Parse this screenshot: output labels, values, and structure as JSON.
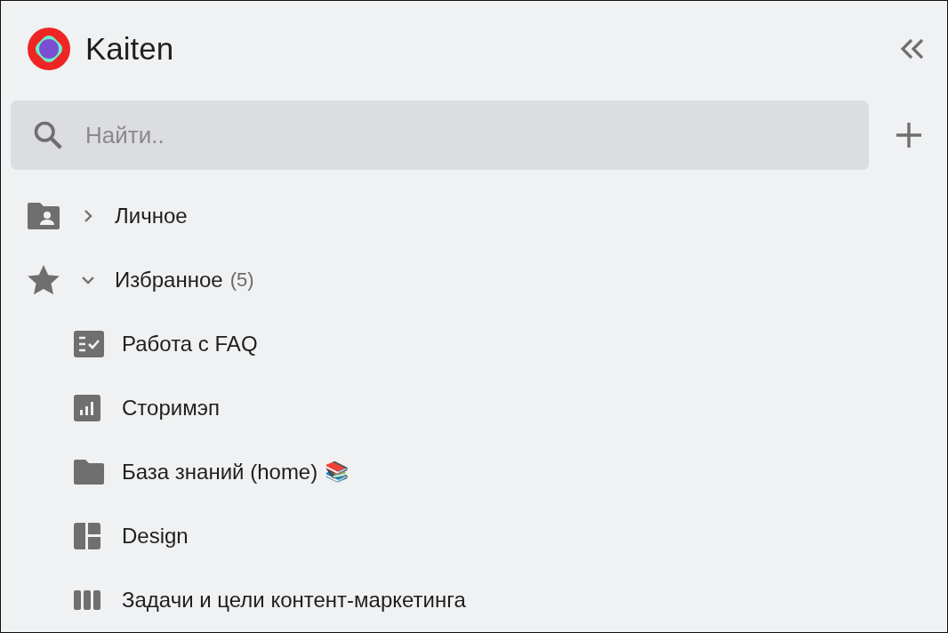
{
  "app": {
    "name": "Kaiten"
  },
  "search": {
    "placeholder": "Найти.."
  },
  "tree": [
    {
      "kind": "personal",
      "label": "Личное",
      "expanded": false
    },
    {
      "kind": "favorites",
      "label": "Избранное",
      "count": "(5)",
      "expanded": true,
      "children": [
        {
          "kind": "checklist",
          "label": "Работа с FAQ"
        },
        {
          "kind": "chart",
          "label": "Сторимэп"
        },
        {
          "kind": "folder",
          "label": "База знаний (home)",
          "emoji": "📚"
        },
        {
          "kind": "layout",
          "label": "Design"
        },
        {
          "kind": "columns",
          "label": "Задачи и цели контент-маркетинга"
        }
      ]
    }
  ]
}
